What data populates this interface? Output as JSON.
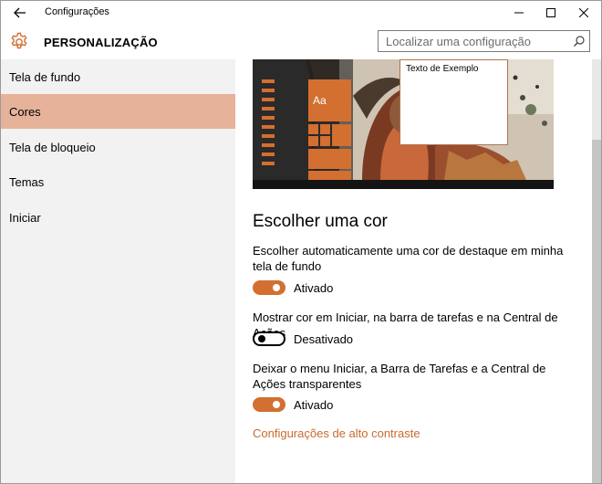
{
  "window": {
    "title": "Configurações"
  },
  "header": {
    "title": "PERSONALIZAÇÃO",
    "search_placeholder": "Localizar uma configuração"
  },
  "sidebar": {
    "items": [
      {
        "label": "Tela de fundo"
      },
      {
        "label": "Cores"
      },
      {
        "label": "Tela de bloqueio"
      },
      {
        "label": "Temas"
      },
      {
        "label": "Iniciar"
      }
    ],
    "active_index": 1
  },
  "preview": {
    "tile_label": "Aa",
    "sample_text": "Texto de Exemplo"
  },
  "main": {
    "section_title": "Escolher uma cor",
    "settings": [
      {
        "label": "Escolher automaticamente uma cor de destaque em minha tela de fundo",
        "state": "Ativado",
        "on": true
      },
      {
        "label": "Mostrar cor em Iniciar, na barra de tarefas e na Central de Ações",
        "state": "Desativado",
        "on": false
      },
      {
        "label": "Deixar o menu Iniciar, a Barra de Tarefas e a Central de Ações transparentes",
        "state": "Ativado",
        "on": true
      }
    ],
    "link": "Configurações de alto contraste"
  },
  "colors": {
    "accent": "#d36f31",
    "sidebar_selected": "#e6b299",
    "link": "#c96a2e",
    "sidebar_bg": "#f2f2f2"
  }
}
